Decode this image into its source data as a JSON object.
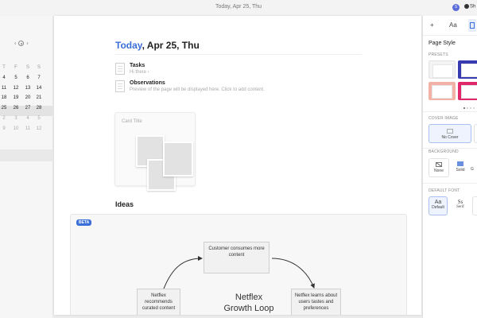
{
  "topbar": {
    "date": "Today, Apr 25, Thu",
    "avatar": "S",
    "share": "Sh"
  },
  "calendar": {
    "headers": [
      "T",
      "F",
      "S",
      "S"
    ],
    "rows": [
      [
        "4",
        "5",
        "6",
        "7"
      ],
      [
        "11",
        "12",
        "13",
        "14"
      ],
      [
        "18",
        "19",
        "20",
        "21"
      ],
      [
        "25",
        "26",
        "27",
        "28"
      ],
      [
        "2",
        "3",
        "4",
        "5"
      ],
      [
        "9",
        "10",
        "11",
        "12"
      ]
    ]
  },
  "page": {
    "today_label": "Today",
    "date_rest": ", Apr 25, Thu",
    "tasks_title": "Tasks",
    "tasks_subtitle": "Hi there ›",
    "observations_title": "Observations",
    "observations_subtitle": "Preview of the page will be displayed here. Click to add content.",
    "card_title": "Card Title",
    "ideas_title": "Ideas",
    "beta_badge": "BETA",
    "diagram": {
      "node_top": "Customer consumes more content",
      "node_left": "Netflex recommends curated content",
      "node_right": "Netflex learns about users tastes and preferences",
      "title_line1": "Netflex",
      "title_line2": "Growth Loop"
    }
  },
  "inspector": {
    "tabs": [
      "+",
      "Aa",
      "page-icon"
    ],
    "title": "Page Style",
    "presets_label": "PRESETS",
    "cover_label": "COVER IMAGE",
    "cover_none": "No Cover",
    "background_label": "BACKGROUND",
    "background_options": [
      "None",
      "Solid",
      "G"
    ],
    "font_label": "DEFAULT FONT",
    "font_options": [
      {
        "glyph": "Aa",
        "name": "Default"
      },
      {
        "glyph": "Ss",
        "name": "Serif"
      }
    ],
    "colors": {
      "accent": "#3b6fd8",
      "preset_blue": "#3a3ab0",
      "preset_pink": "#e0286a",
      "preset_salmon": "#f2b3a6"
    }
  }
}
